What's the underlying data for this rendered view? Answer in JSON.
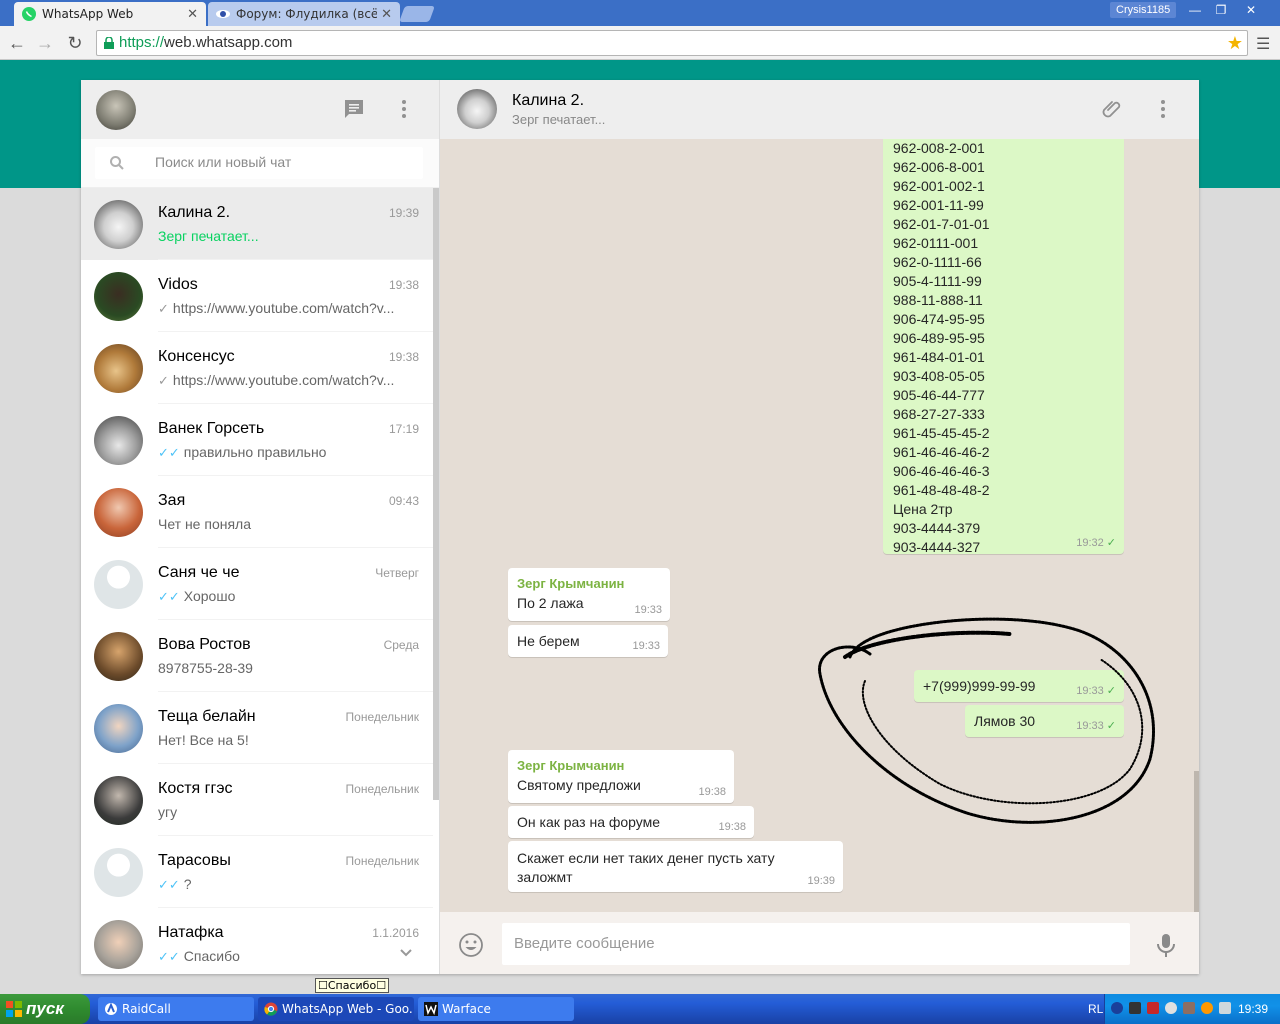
{
  "browser": {
    "tabs": [
      {
        "title": "WhatsApp Web",
        "active": true
      },
      {
        "title": "Форум: Флудилка (всё обо",
        "active": false
      }
    ],
    "user_badge": "Crysis1185",
    "url_scheme": "https://",
    "url_host": "web.whatsapp.com"
  },
  "sidebar": {
    "search_placeholder": "Поиск или новый чат",
    "chats": [
      {
        "name": "Калина 2.",
        "time": "19:39",
        "preview": "Зерг печатает...",
        "tick": "",
        "typing": true,
        "active": true
      },
      {
        "name": "Vidos",
        "time": "19:38",
        "preview": "https://www.youtube.com/watch?v...",
        "tick": "✓",
        "typing": false
      },
      {
        "name": "Консенсус",
        "time": "19:38",
        "preview": "https://www.youtube.com/watch?v...",
        "tick": "✓",
        "typing": false
      },
      {
        "name": "Ванек Горсеть",
        "time": "17:19",
        "preview": "правильно правильно",
        "tick": "✓✓",
        "typing": false
      },
      {
        "name": "Зая",
        "time": "09:43",
        "preview": "Чет не поняла",
        "tick": "",
        "typing": false
      },
      {
        "name": "Саня че че",
        "time": "Четверг",
        "preview": "Хорошо",
        "tick": "✓✓",
        "typing": false
      },
      {
        "name": "Вова Ростов",
        "time": "Среда",
        "preview": "8978755-28-39",
        "tick": "",
        "typing": false
      },
      {
        "name": "Теща белайн",
        "time": "Понедельник",
        "preview": "Нет! Все на 5!",
        "tick": "",
        "typing": false
      },
      {
        "name": "Костя ггэс",
        "time": "Понедельник",
        "preview": "угу",
        "tick": "",
        "typing": false
      },
      {
        "name": "Тарасовы",
        "time": "Понедельник",
        "preview": "?",
        "tick": "✓✓",
        "typing": false
      },
      {
        "name": "Натафка",
        "time": "1.1.2016",
        "preview": "Спасибо",
        "tick": "✓✓",
        "typing": false
      }
    ]
  },
  "conversation": {
    "title": "Калина 2.",
    "status": "Зерг печатает...",
    "big_list": {
      "lines": [
        "962-008-2-001",
        "962-006-8-001",
        "962-001-002-1",
        "962-001-11-99",
        "962-01-7-01-01",
        "962-0111-001",
        "962-0-1111-66",
        "905-4-1111-99",
        "988-11-888-11",
        "906-474-95-95",
        "906-489-95-95",
        "961-484-01-01",
        "903-408-05-05",
        "905-46-44-777",
        "968-27-27-333",
        "961-45-45-45-2",
        "961-46-46-46-2",
        "906-46-46-46-3",
        "961-48-48-48-2",
        "Цена 2тр",
        "903-4444-379",
        "903-4444-327"
      ],
      "time": "19:32",
      "check": "✓"
    },
    "messages": [
      {
        "sender": "Зерг Крымчанин",
        "text": "По 2 лажа",
        "time": "19:33"
      },
      {
        "text": "Не берем",
        "time": "19:33"
      },
      {
        "text": "+7(999)999-99-99",
        "time": "19:33",
        "check": "✓"
      },
      {
        "text": "Лямов 30",
        "time": "19:33",
        "check": "✓"
      },
      {
        "sender": "Зерг Крымчанин",
        "text": "Святому предложи",
        "time": "19:38"
      },
      {
        "text": "Он как раз на форуме",
        "time": "19:38"
      },
      {
        "text": "Скажет если нет таких денег пусть хату заложмт",
        "time": "19:39"
      }
    ],
    "input_placeholder": "Введите сообщение"
  },
  "tooltip": "Спасибо",
  "taskbar": {
    "start": "пуск",
    "tasks": [
      "RaidCall",
      "WhatsApp Web - Goo...",
      "Warface"
    ],
    "lang": "RL",
    "clock": "19:39"
  },
  "colors": {
    "teal_header": "#009688",
    "outgoing_bubble": "#dcf8c6",
    "sender_name": "#7cb342",
    "typing": "#09d261",
    "read_tick": "#4fc3f7"
  }
}
